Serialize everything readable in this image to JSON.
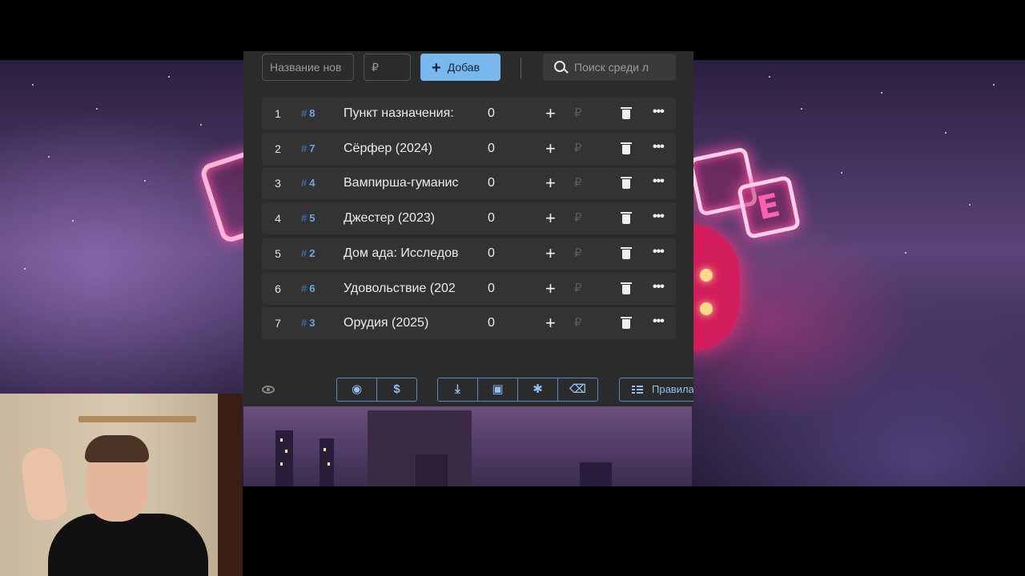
{
  "toolbar": {
    "name_placeholder": "Название нов",
    "price_placeholder": "₽",
    "add_label": "Добав",
    "search_placeholder": "Поиск среди л"
  },
  "items": [
    {
      "num": "1",
      "id": "8",
      "title": "Пункт назначения:",
      "score": "0"
    },
    {
      "num": "2",
      "id": "7",
      "title": "Сёрфер (2024)",
      "score": "0"
    },
    {
      "num": "3",
      "id": "4",
      "title": "Вампирша-гуманис",
      "score": "0"
    },
    {
      "num": "4",
      "id": "5",
      "title": "Джестер (2023)",
      "score": "0"
    },
    {
      "num": "5",
      "id": "2",
      "title": "Дом ада: Исследов",
      "score": "0"
    },
    {
      "num": "6",
      "id": "6",
      "title": "Удовольствие (202",
      "score": "0"
    },
    {
      "num": "7",
      "id": "3",
      "title": "Орудия (2025)",
      "score": "0"
    }
  ],
  "row_symbols": {
    "hash": "#",
    "plus": "+",
    "currency": "₽",
    "more": "•••"
  },
  "bottombar": {
    "group1": [
      {
        "icon": "github-icon",
        "glyph": "◉"
      },
      {
        "icon": "dollar-icon",
        "glyph": "$"
      }
    ],
    "group2": [
      {
        "icon": "download-icon",
        "glyph": "⤓"
      },
      {
        "icon": "save-icon",
        "glyph": "▣"
      },
      {
        "icon": "bug-icon",
        "glyph": "✱"
      },
      {
        "icon": "clear-list-icon",
        "glyph": "⌫"
      }
    ],
    "rules_label": "Правила"
  },
  "colors": {
    "accent": "#78b8ee",
    "panel": "#2b2b2b",
    "row": "#333333",
    "id_blue": "#6aa6e8"
  }
}
